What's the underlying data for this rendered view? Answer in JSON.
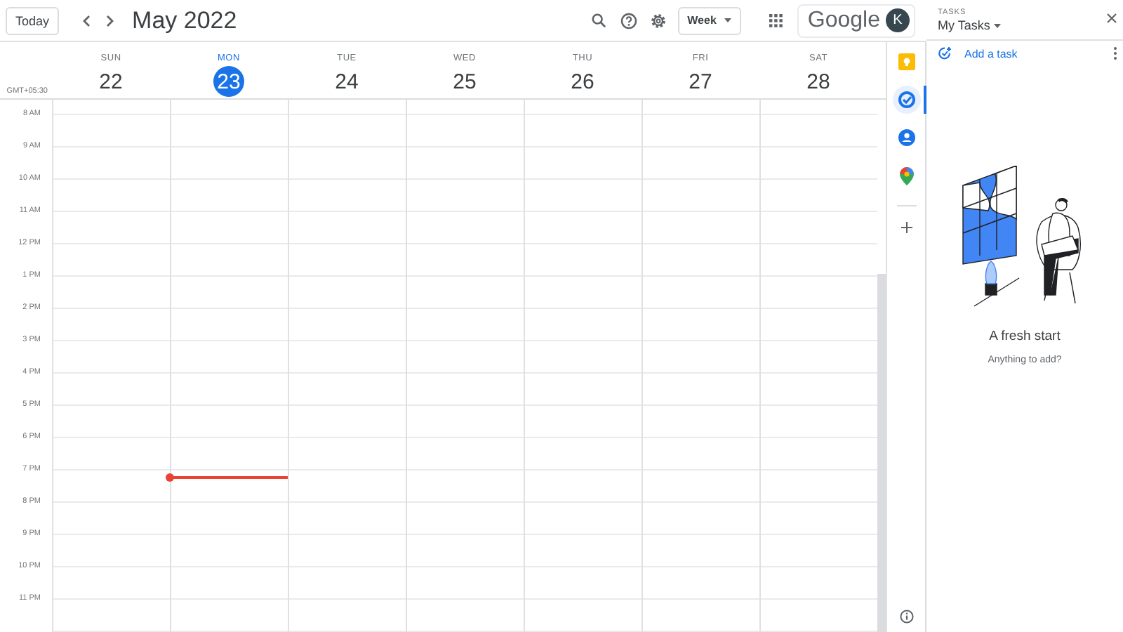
{
  "header": {
    "today_button": "Today",
    "title": "May 2022",
    "view_select": "Week",
    "brand": "Google",
    "avatar_initial": "K"
  },
  "timezone": "GMT+05:30",
  "days": [
    {
      "name": "SUN",
      "date": "22",
      "selected": false
    },
    {
      "name": "MON",
      "date": "23",
      "selected": true
    },
    {
      "name": "TUE",
      "date": "24",
      "selected": false
    },
    {
      "name": "WED",
      "date": "25",
      "selected": false
    },
    {
      "name": "THU",
      "date": "26",
      "selected": false
    },
    {
      "name": "FRI",
      "date": "27",
      "selected": false
    },
    {
      "name": "SAT",
      "date": "28",
      "selected": false
    }
  ],
  "hours": [
    "8 AM",
    "9 AM",
    "10 AM",
    "11 AM",
    "12 PM",
    "1 PM",
    "2 PM",
    "3 PM",
    "4 PM",
    "5 PM",
    "6 PM",
    "7 PM",
    "8 PM",
    "9 PM",
    "10 PM",
    "11 PM"
  ],
  "side_rail": [
    {
      "kind": "keep",
      "selected": false
    },
    {
      "kind": "tasks",
      "selected": true
    },
    {
      "kind": "contacts",
      "selected": false
    },
    {
      "kind": "maps",
      "selected": false
    }
  ],
  "tasks_panel": {
    "label": "TASKS",
    "list_name": "My Tasks",
    "add_task": "Add a task",
    "empty_title": "A fresh start",
    "empty_subtitle": "Anything to add?"
  }
}
